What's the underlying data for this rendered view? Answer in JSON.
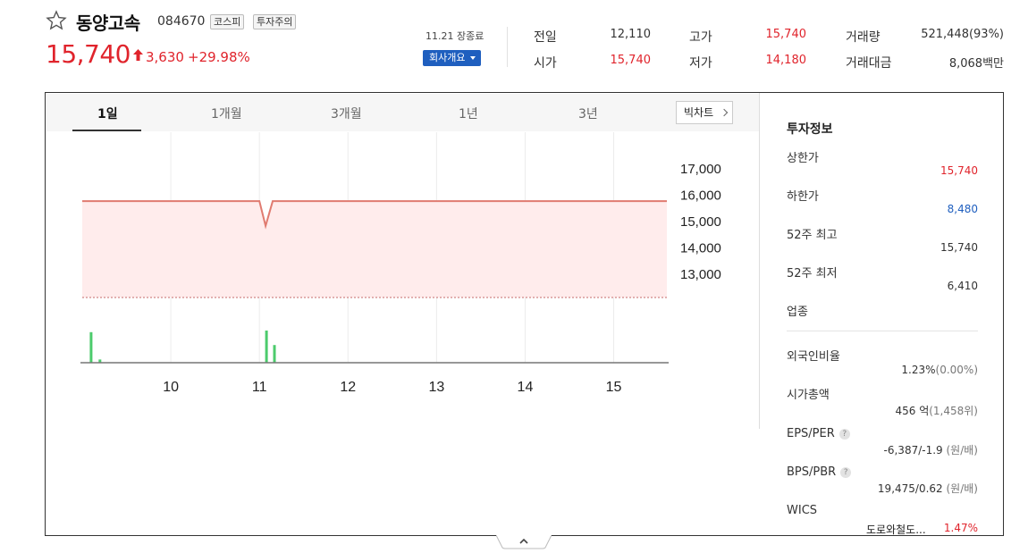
{
  "header": {
    "name": "동양고속",
    "code": "084670",
    "market_badge": "코스피",
    "warning_badge": "투자주의",
    "price": "15,740",
    "change": "3,630",
    "change_rate": "+29.98%",
    "close_time": "11.21 장종료",
    "company_button": "회사개요"
  },
  "quote": {
    "prev_close_label": "전일",
    "prev_close": "12,110",
    "open_label": "시가",
    "open": "15,740",
    "high_label": "고가",
    "high": "15,740",
    "low_label": "저가",
    "low": "14,180",
    "volume_label": "거래량",
    "volume": "521,448(93%)",
    "amount_label": "거래대금",
    "amount": "8,068백만"
  },
  "tabs": [
    "1일",
    "1개월",
    "3개월",
    "1년",
    "3년"
  ],
  "bitchart_label": "빅차트",
  "colors": {
    "up": "#e0242c",
    "down": "#1f5fbf",
    "volume_bar": "#4ccb6c",
    "line": "#e07b70",
    "fill": "#ffecec"
  },
  "chart_data": {
    "type": "line",
    "y_ticks": [
      "17,000",
      "16,000",
      "15,000",
      "14,000",
      "13,000"
    ],
    "x_ticks": [
      "10",
      "11",
      "12",
      "13",
      "14",
      "15"
    ],
    "ylim": [
      13000,
      17000
    ],
    "xlim": [
      9.0,
      15.6
    ],
    "baseline": 12110,
    "series": [
      {
        "values": [
          [
            9.0,
            15740
          ],
          [
            10.0,
            15740
          ],
          [
            11.0,
            15740
          ],
          [
            11.07,
            14800
          ],
          [
            11.15,
            15740
          ],
          [
            12.0,
            15740
          ],
          [
            13.0,
            15740
          ],
          [
            14.0,
            15740
          ],
          [
            15.0,
            15740
          ],
          [
            15.6,
            15740
          ]
        ]
      }
    ],
    "volume": [
      [
        9.1,
        0.95
      ],
      [
        9.2,
        0.1
      ],
      [
        11.08,
        1.0
      ],
      [
        11.17,
        0.55
      ]
    ]
  },
  "info": {
    "title": "투자정보",
    "upper_limit_label": "상한가",
    "upper_limit": "15,740",
    "lower_limit_label": "하한가",
    "lower_limit": "8,480",
    "high52_label": "52주 최고",
    "high52": "15,740",
    "low52_label": "52주 최저",
    "low52": "6,410",
    "industry_label": "업종",
    "foreign_label": "외국인비율",
    "foreign": "1.23%",
    "foreign_sub": "(0.00%)",
    "mcap_label": "시가총액",
    "mcap": "456",
    "mcap_unit": "억",
    "mcap_sub": "(1,458위)",
    "eps_label": "EPS/PER",
    "eps": "-6,387/-1.9",
    "eps_unit": "(원/배)",
    "bps_label": "BPS/PBR",
    "bps": "19,475/0.62",
    "bps_unit": "(원/배)",
    "qmark": "?",
    "wics_label": "WICS",
    "wics_name": "도로와철도...",
    "wics_rate": "1.47%"
  }
}
